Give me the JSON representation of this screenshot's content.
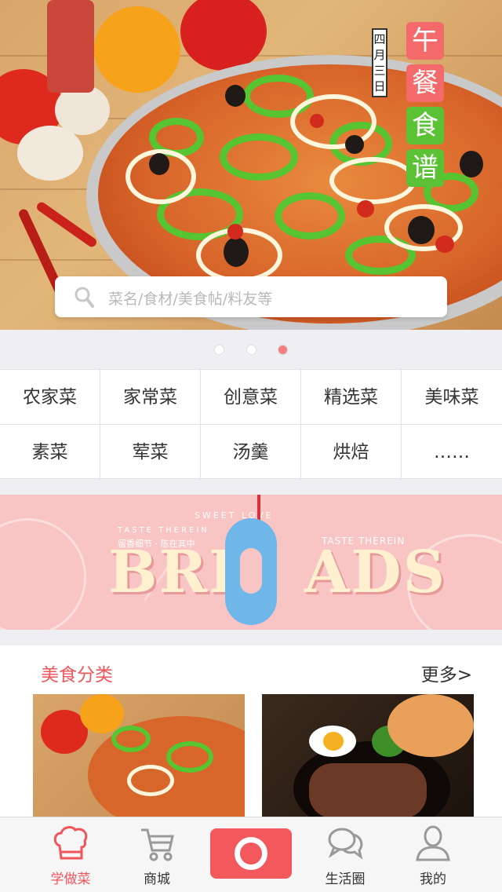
{
  "hero": {
    "title_chars": [
      "午",
      "餐",
      "食",
      "谱"
    ],
    "title_colors": [
      "#f46a6a",
      "#f46a6a",
      "#5bc236",
      "#5bc236"
    ],
    "date_chars": [
      "四",
      "月",
      "三",
      "日"
    ]
  },
  "search": {
    "placeholder": "菜名/食材/美食帖/料友等",
    "icon": "search-icon"
  },
  "carousel": {
    "count": 3,
    "active_index": 2
  },
  "categories": [
    "农家菜",
    "家常菜",
    "创意菜",
    "精选菜",
    "美味菜",
    "素菜",
    "荤菜",
    "汤羹",
    "烘焙",
    "……"
  ],
  "banner": {
    "word_left": "BRE",
    "word_right": "ADS",
    "top_text": "SWEET LOVE",
    "left_small": "TASTE THEREIN",
    "left_slogan": "留香细节 · 陈在其中",
    "right_small": "TASTE THEREIN"
  },
  "section": {
    "title": "美食分类",
    "more": "更多>"
  },
  "tabbar": {
    "items": [
      {
        "label": "学做菜",
        "icon": "chef-hat-icon",
        "active": true
      },
      {
        "label": "商城",
        "icon": "cart-icon",
        "active": false
      },
      {
        "label": "生活圈",
        "icon": "chat-bubbles-icon",
        "active": false
      },
      {
        "label": "我的",
        "icon": "user-icon",
        "active": false
      }
    ],
    "center_icon": "camera-icon"
  },
  "colors": {
    "accent": "#f0555a",
    "active_dot": "#f47f7f",
    "banner_bg": "#f8c4c4"
  }
}
